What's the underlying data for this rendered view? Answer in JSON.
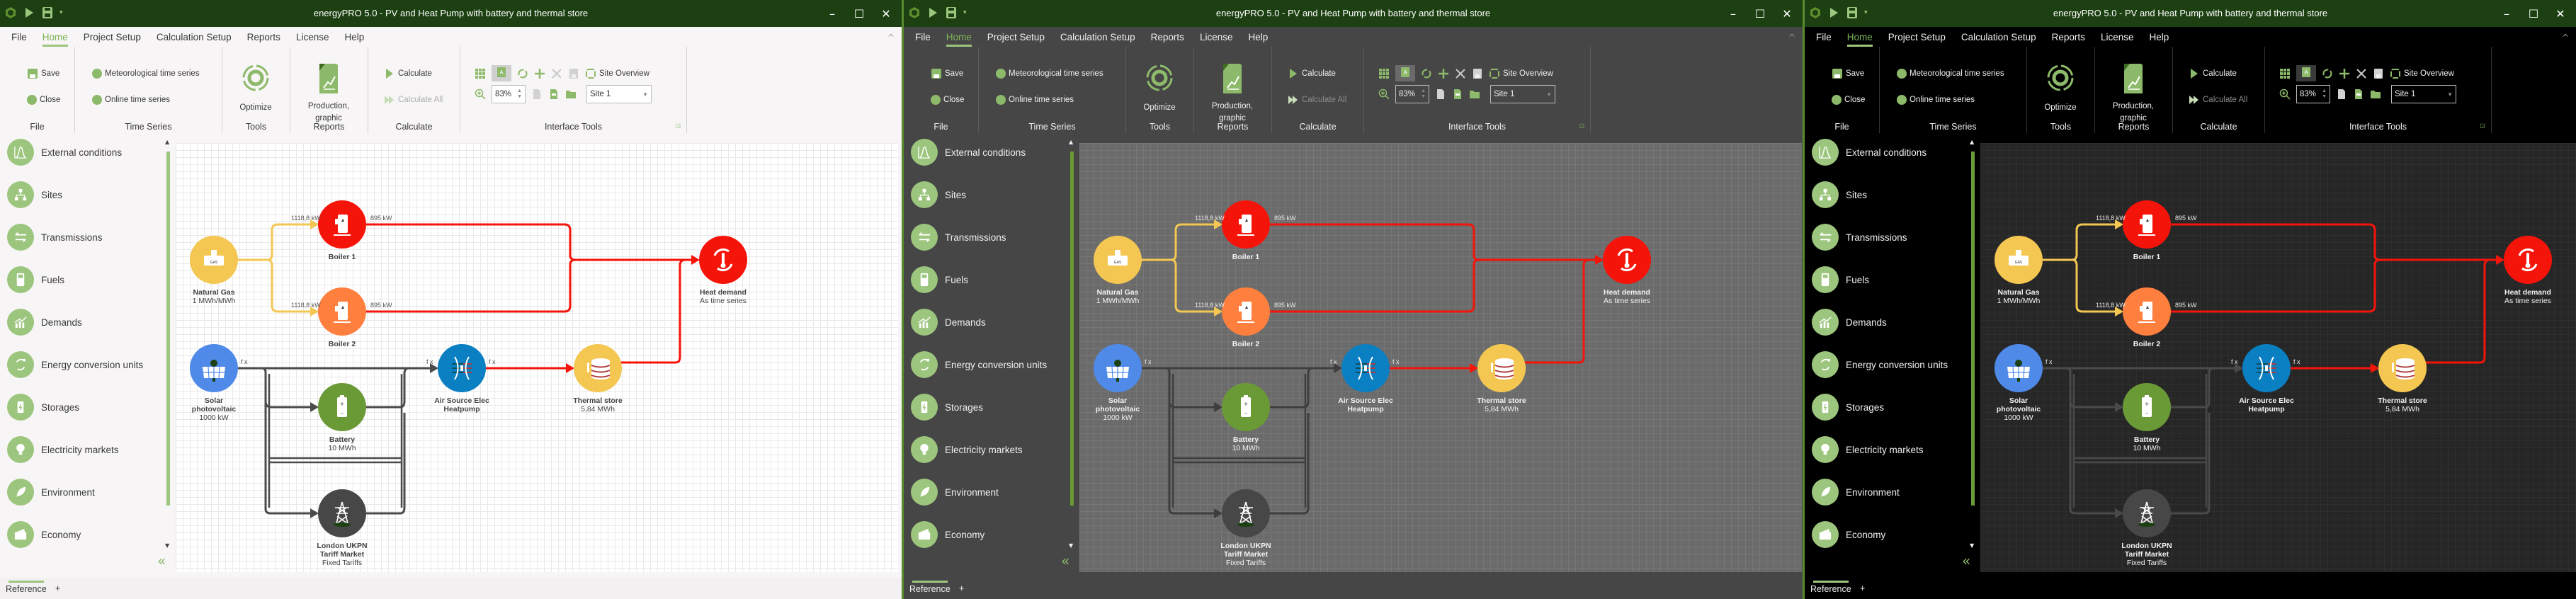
{
  "app": {
    "title": "energyPRO 5.0  -  PV and Heat Pump with battery and thermal store",
    "window_controls": {
      "minimize": "–",
      "maximize": "☐",
      "close": "✕"
    },
    "collapse_ribbon": "^"
  },
  "menu": {
    "tabs": [
      {
        "label": "File"
      },
      {
        "label": "Home",
        "active": true
      },
      {
        "label": "Project Setup"
      },
      {
        "label": "Calculation Setup"
      },
      {
        "label": "Reports"
      },
      {
        "label": "License"
      },
      {
        "label": "Help"
      }
    ]
  },
  "ribbon": {
    "file": {
      "group": "File",
      "save": "Save",
      "close": "Close"
    },
    "time_series": {
      "group": "Time Series",
      "meteorological": "Meteorological time series",
      "online": "Online time series"
    },
    "tools": {
      "group": "Tools",
      "optimize": "Optimize"
    },
    "reports": {
      "group": "Reports",
      "production_line1": "Production,",
      "production_line2": "graphic"
    },
    "calculate": {
      "group": "Calculate",
      "calculate": "Calculate",
      "calculate_all": "Calculate All"
    },
    "interface_tools": {
      "group": "Interface Tools",
      "site_overview": "Site Overview",
      "zoom_value": "83%",
      "site_selected": "Site 1"
    }
  },
  "sidebar": {
    "items": [
      {
        "label": "External conditions",
        "icon": "distribution-chart-icon"
      },
      {
        "label": "Sites",
        "icon": "hierarchy-icon"
      },
      {
        "label": "Transmissions",
        "icon": "transfer-arrows-icon"
      },
      {
        "label": "Fuels",
        "icon": "fuel-pump-icon"
      },
      {
        "label": "Demands",
        "icon": "bar-chart-trend-icon"
      },
      {
        "label": "Energy conversion units",
        "icon": "conversion-icon"
      },
      {
        "label": "Storages",
        "icon": "battery-storage-icon"
      },
      {
        "label": "Electricity markets",
        "icon": "lightbulb-icon"
      },
      {
        "label": "Environment",
        "icon": "leaf-icon"
      },
      {
        "label": "Economy",
        "icon": "wallet-icon"
      }
    ],
    "collapse_label": "«"
  },
  "diagram": {
    "nodes": [
      {
        "id": "natural_gas",
        "name": "Natural Gas",
        "sub": "1 MWh/MWh",
        "color": "#f4c752",
        "icon": "gas-valve-icon"
      },
      {
        "id": "boiler1",
        "name": "Boiler 1",
        "sub": "",
        "color": "#f5140a",
        "icon": "boiler-icon"
      },
      {
        "id": "boiler2",
        "name": "Boiler 2",
        "sub": "",
        "color": "#ff7f3f",
        "icon": "boiler-icon"
      },
      {
        "id": "heat_demand",
        "name": "Heat demand",
        "sub": "As time series",
        "color": "#f5140a",
        "icon": "thermometer-cycle-icon"
      },
      {
        "id": "solar",
        "name": "Solar",
        "name2": "photovoltaic",
        "sub": "1000 kW",
        "color": "#4f8ae8",
        "icon": "solar-panel-icon"
      },
      {
        "id": "battery",
        "name": "Battery",
        "sub": "10 MWh",
        "color": "#6a9a36",
        "icon": "battery-icon"
      },
      {
        "id": "heatpump",
        "name": "Air Source Elec",
        "name2": "Heatpump",
        "sub": "",
        "color": "#0a7fc2",
        "icon": "heatpump-icon"
      },
      {
        "id": "thermal_store",
        "name": "Thermal store",
        "sub": "5,84 MWh",
        "color": "#f4c752",
        "icon": "thermal-store-icon"
      },
      {
        "id": "grid",
        "name": "London UKPN",
        "name2": "Tariff Market",
        "sub": "Fixed Tariffs",
        "color": "#474747",
        "icon": "pylon-icon"
      }
    ],
    "flows": {
      "gas_to_boiler1": "1118,8 kW",
      "gas_to_boiler2": "1118,8 kW",
      "boiler1_out": "895 kW",
      "boiler2_out": "895 kW",
      "fx": "f x"
    },
    "colors": {
      "heat": "#f5140a",
      "gas": "#f4c752",
      "electricity": "#4b4b4b"
    }
  },
  "statusbar": {
    "tab": "Reference",
    "add": "+"
  },
  "themes": [
    "light",
    "gray",
    "black"
  ]
}
